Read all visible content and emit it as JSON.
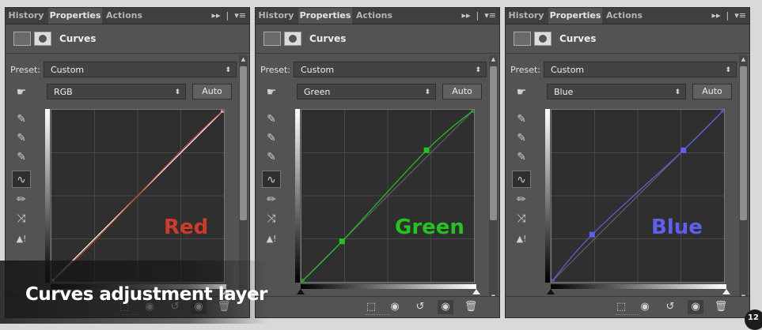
{
  "panels": [
    {
      "tabs": [
        "History",
        "Properties",
        "Actions"
      ],
      "title": "Curves",
      "preset_label": "Preset:",
      "preset_value": "Custom",
      "channel": "RGB",
      "auto_label": "Auto",
      "curve_label": "Red",
      "curve_color": "#cf3b2a",
      "curve_points": [
        [
          0,
          0
        ],
        [
          255,
          255
        ]
      ]
    },
    {
      "tabs": [
        "History",
        "Properties",
        "Actions"
      ],
      "title": "Curves",
      "preset_label": "Preset:",
      "preset_value": "Custom",
      "channel": "Green",
      "auto_label": "Auto",
      "curve_label": "Green",
      "curve_color": "#23c41f",
      "curve_points": [
        [
          0,
          0
        ],
        [
          60,
          60
        ],
        [
          185,
          195
        ],
        [
          255,
          255
        ]
      ]
    },
    {
      "tabs": [
        "History",
        "Properties",
        "Actions"
      ],
      "title": "Curves",
      "preset_label": "Preset:",
      "preset_value": "Custom",
      "channel": "Blue",
      "auto_label": "Auto",
      "curve_label": "Blue",
      "curve_color": "#5f5ff0",
      "curve_points": [
        [
          0,
          0
        ],
        [
          60,
          70
        ],
        [
          195,
          195
        ],
        [
          255,
          255
        ]
      ]
    }
  ],
  "tools": [
    "hand-adjust-icon",
    "eyedropper-black-icon",
    "eyedropper-gray-icon",
    "eyedropper-white-icon",
    "curve-edit-icon",
    "pencil-icon",
    "smooth-icon",
    "clipping-warning-icon"
  ],
  "bottom_icons": [
    "clip-to-layer-icon",
    "view-previous-icon",
    "reset-icon",
    "visibility-icon",
    "delete-icon"
  ],
  "caption": "Curves adjustment layer",
  "corner_badge": "12"
}
